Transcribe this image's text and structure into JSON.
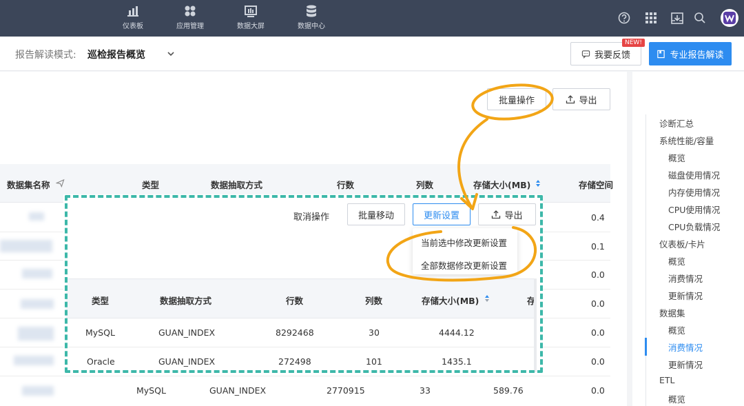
{
  "topnav": {
    "items": [
      {
        "label": "仪表板",
        "icon": "bar-chart-icon"
      },
      {
        "label": "应用管理",
        "icon": "apps-icon"
      },
      {
        "label": "数据大屏",
        "icon": "screen-icon"
      },
      {
        "label": "数据中心",
        "icon": "database-icon"
      }
    ]
  },
  "subbar": {
    "mode_label": "报告解读模式:",
    "mode_value": "巡检报告概览",
    "feedback_label": "我要反馈",
    "new_badge": "NEW!",
    "pro_label": "专业报告解读"
  },
  "toolbar": {
    "batch_label": "批量操作",
    "export_label": "导出"
  },
  "table": {
    "headers": [
      "数据集名称",
      "类型",
      "数据抽取方式",
      "行数",
      "列数",
      "存储大小(MB)",
      "存储空间"
    ],
    "rows": [
      {
        "size_tail": "0.4"
      },
      {
        "size_tail": "0.1"
      },
      {
        "size_tail": "0.0"
      },
      {
        "size_tail": "0.0"
      },
      {
        "size_tail": "0.0"
      },
      {
        "size_tail": "0.0"
      },
      {
        "type": "MySQL",
        "method": "GUAN_INDEX",
        "rows": "2770915",
        "cols": "33",
        "size": "589.76",
        "size_tail": "0.0"
      }
    ]
  },
  "batch_panel": {
    "cancel_label": "取消操作",
    "move_label": "批量移动",
    "update_label": "更新设置",
    "export_label": "导出",
    "dropdown": [
      "当前选中修改更新设置",
      "全部数据修改更新设置"
    ],
    "headers": [
      "类型",
      "数据抽取方式",
      "行数",
      "列数",
      "存储大小(MB)",
      "存"
    ],
    "rows": [
      {
        "type": "MySQL",
        "method": "GUAN_INDEX",
        "rows": "8292468",
        "cols": "30",
        "size": "4444.12"
      },
      {
        "type": "Oracle",
        "method": "GUAN_INDEX",
        "rows": "272498",
        "cols": "101",
        "size": "1435.1"
      }
    ]
  },
  "sidebar": {
    "items": [
      {
        "label": "诊断汇总",
        "level": 1
      },
      {
        "label": "系统性能/容量",
        "level": 1
      },
      {
        "label": "概览",
        "level": 2
      },
      {
        "label": "磁盘使用情况",
        "level": 2
      },
      {
        "label": "内存使用情况",
        "level": 2
      },
      {
        "label": "CPU使用情况",
        "level": 2
      },
      {
        "label": "CPU负载情况",
        "level": 2
      },
      {
        "label": "仪表板/卡片",
        "level": 1
      },
      {
        "label": "概览",
        "level": 2
      },
      {
        "label": "消费情况",
        "level": 2
      },
      {
        "label": "更新情况",
        "level": 2
      },
      {
        "label": "数据集",
        "level": 1
      },
      {
        "label": "概览",
        "level": 2
      },
      {
        "label": "消费情况",
        "level": 2,
        "active": true
      },
      {
        "label": "更新情况",
        "level": 2
      },
      {
        "label": "ETL",
        "level": 1
      },
      {
        "label": "概览",
        "level": 2
      }
    ]
  },
  "colors": {
    "topbar": "#3c4659",
    "accent": "#2d8cf0",
    "annotation_orange": "#f2a516",
    "annotation_teal": "#3db8a9"
  }
}
